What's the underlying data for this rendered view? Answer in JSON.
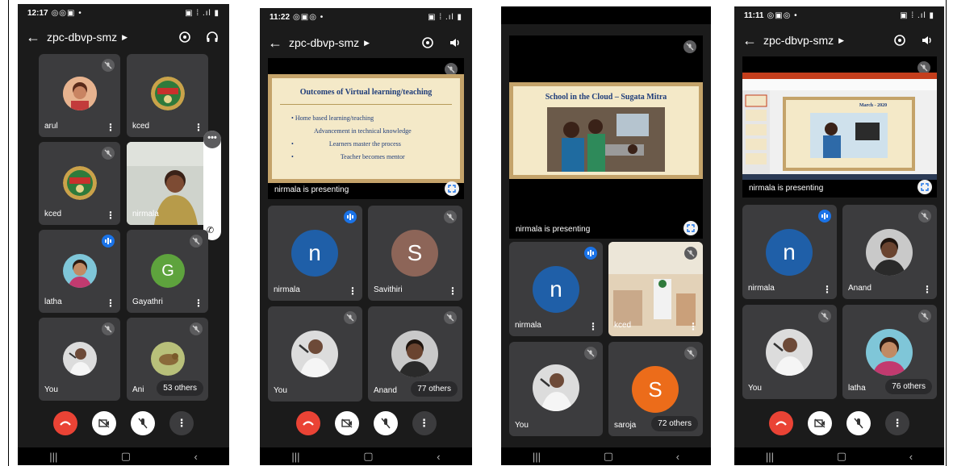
{
  "colors": {
    "bg": "#1b1b1b",
    "tile": "#3c3c3e",
    "end_call": "#ea4335",
    "talking": "#1a73e8"
  },
  "phones": [
    {
      "status_time": "12:17",
      "meeting_code": "zpc-dbvp-smz",
      "tiles": [
        {
          "name": "arul"
        },
        {
          "name": "kced"
        },
        {
          "name": "kced"
        },
        {
          "name": "nirmala"
        },
        {
          "name": "latha"
        },
        {
          "name": "Gayathri",
          "letter": "G"
        },
        {
          "name": "You"
        },
        {
          "name": "Ani",
          "others": "53 others"
        }
      ]
    },
    {
      "status_time": "11:22",
      "meeting_code": "zpc-dbvp-smz",
      "presenting": "nirmala is presenting",
      "slide": {
        "title": "Outcomes of Virtual learning/teaching",
        "bullets": [
          "Home based learning/teaching",
          "Advancement in technical knowledge",
          "Learners master the process",
          "Teacher becomes mentor"
        ]
      },
      "tiles": [
        {
          "name": "nirmala",
          "letter": "n"
        },
        {
          "name": "Savithiri",
          "letter": "S"
        },
        {
          "name": "You"
        },
        {
          "name": "Anand",
          "others": "77 others"
        }
      ]
    },
    {
      "presenting": "nirmala is presenting",
      "slide": {
        "title": "School in the Cloud – Sugata Mitra"
      },
      "tiles": [
        {
          "name": "nirmala",
          "letter": "n"
        },
        {
          "name": "kced"
        },
        {
          "name": "You"
        },
        {
          "name": "saroja",
          "letter": "S",
          "others": "72 others"
        }
      ]
    },
    {
      "status_time": "11:11",
      "meeting_code": "zpc-dbvp-smz",
      "presenting": "nirmala is presenting",
      "slide": {
        "title": "March - 2020"
      },
      "tiles": [
        {
          "name": "nirmala",
          "letter": "n"
        },
        {
          "name": "Anand"
        },
        {
          "name": "You"
        },
        {
          "name": "latha",
          "others": "76 others"
        }
      ]
    }
  ]
}
